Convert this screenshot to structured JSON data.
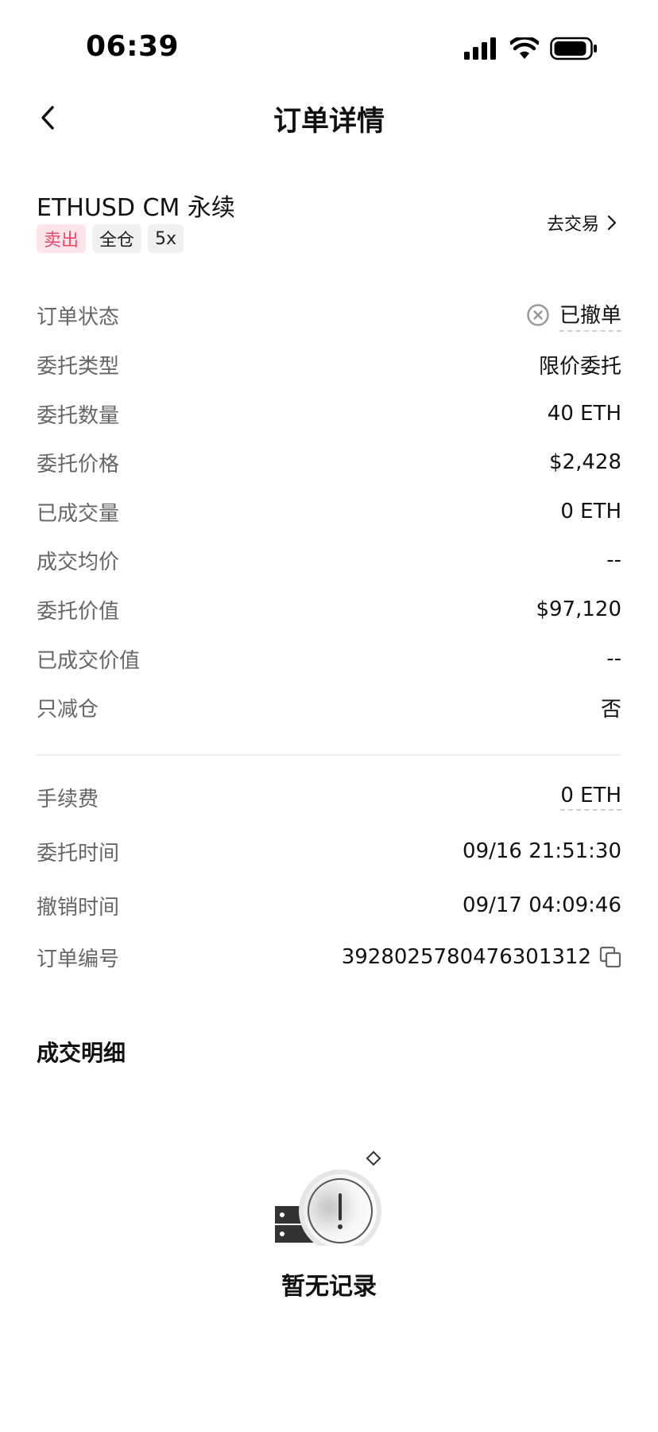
{
  "status_bar": {
    "time": "06:39",
    "icons": [
      "signal-icon",
      "wifi-icon",
      "battery-icon"
    ]
  },
  "nav": {
    "title": "订单详情",
    "back_icon": "chevron-left-icon"
  },
  "instrument": {
    "name": "ETHUSD CM 永续",
    "tags": [
      "卖出",
      "全仓",
      "5x"
    ],
    "trade_link": "去交易"
  },
  "details": [
    {
      "label": "订单状态",
      "value": "已撤单"
    },
    {
      "label": "委托类型",
      "value": "限价委托"
    },
    {
      "label": "委托数量",
      "value": "40 ETH"
    },
    {
      "label": "委托价格",
      "value": "$2,428"
    },
    {
      "label": "已成交量",
      "value": "0 ETH"
    },
    {
      "label": "成交均价",
      "value": "--"
    },
    {
      "label": "委托价值",
      "value": "$97,120"
    },
    {
      "label": "已成交价值",
      "value": "--"
    },
    {
      "label": "只减仓",
      "value": "否"
    }
  ],
  "extra": [
    {
      "label": "手续费",
      "value": "0 ETH"
    },
    {
      "label": "委托时间",
      "value": "09/16 21:51:30"
    },
    {
      "label": "撤销时间",
      "value": "09/17 04:09:46"
    },
    {
      "label": "订单编号",
      "value": "3928025780476301312"
    }
  ],
  "trades": {
    "title": "成交明细",
    "empty_text": "暂无记录"
  },
  "colors": {
    "sell_tag_bg": "#fde4ea",
    "sell_tag_text": "#e8496e",
    "label_text": "#666666",
    "value_text": "#111111"
  }
}
